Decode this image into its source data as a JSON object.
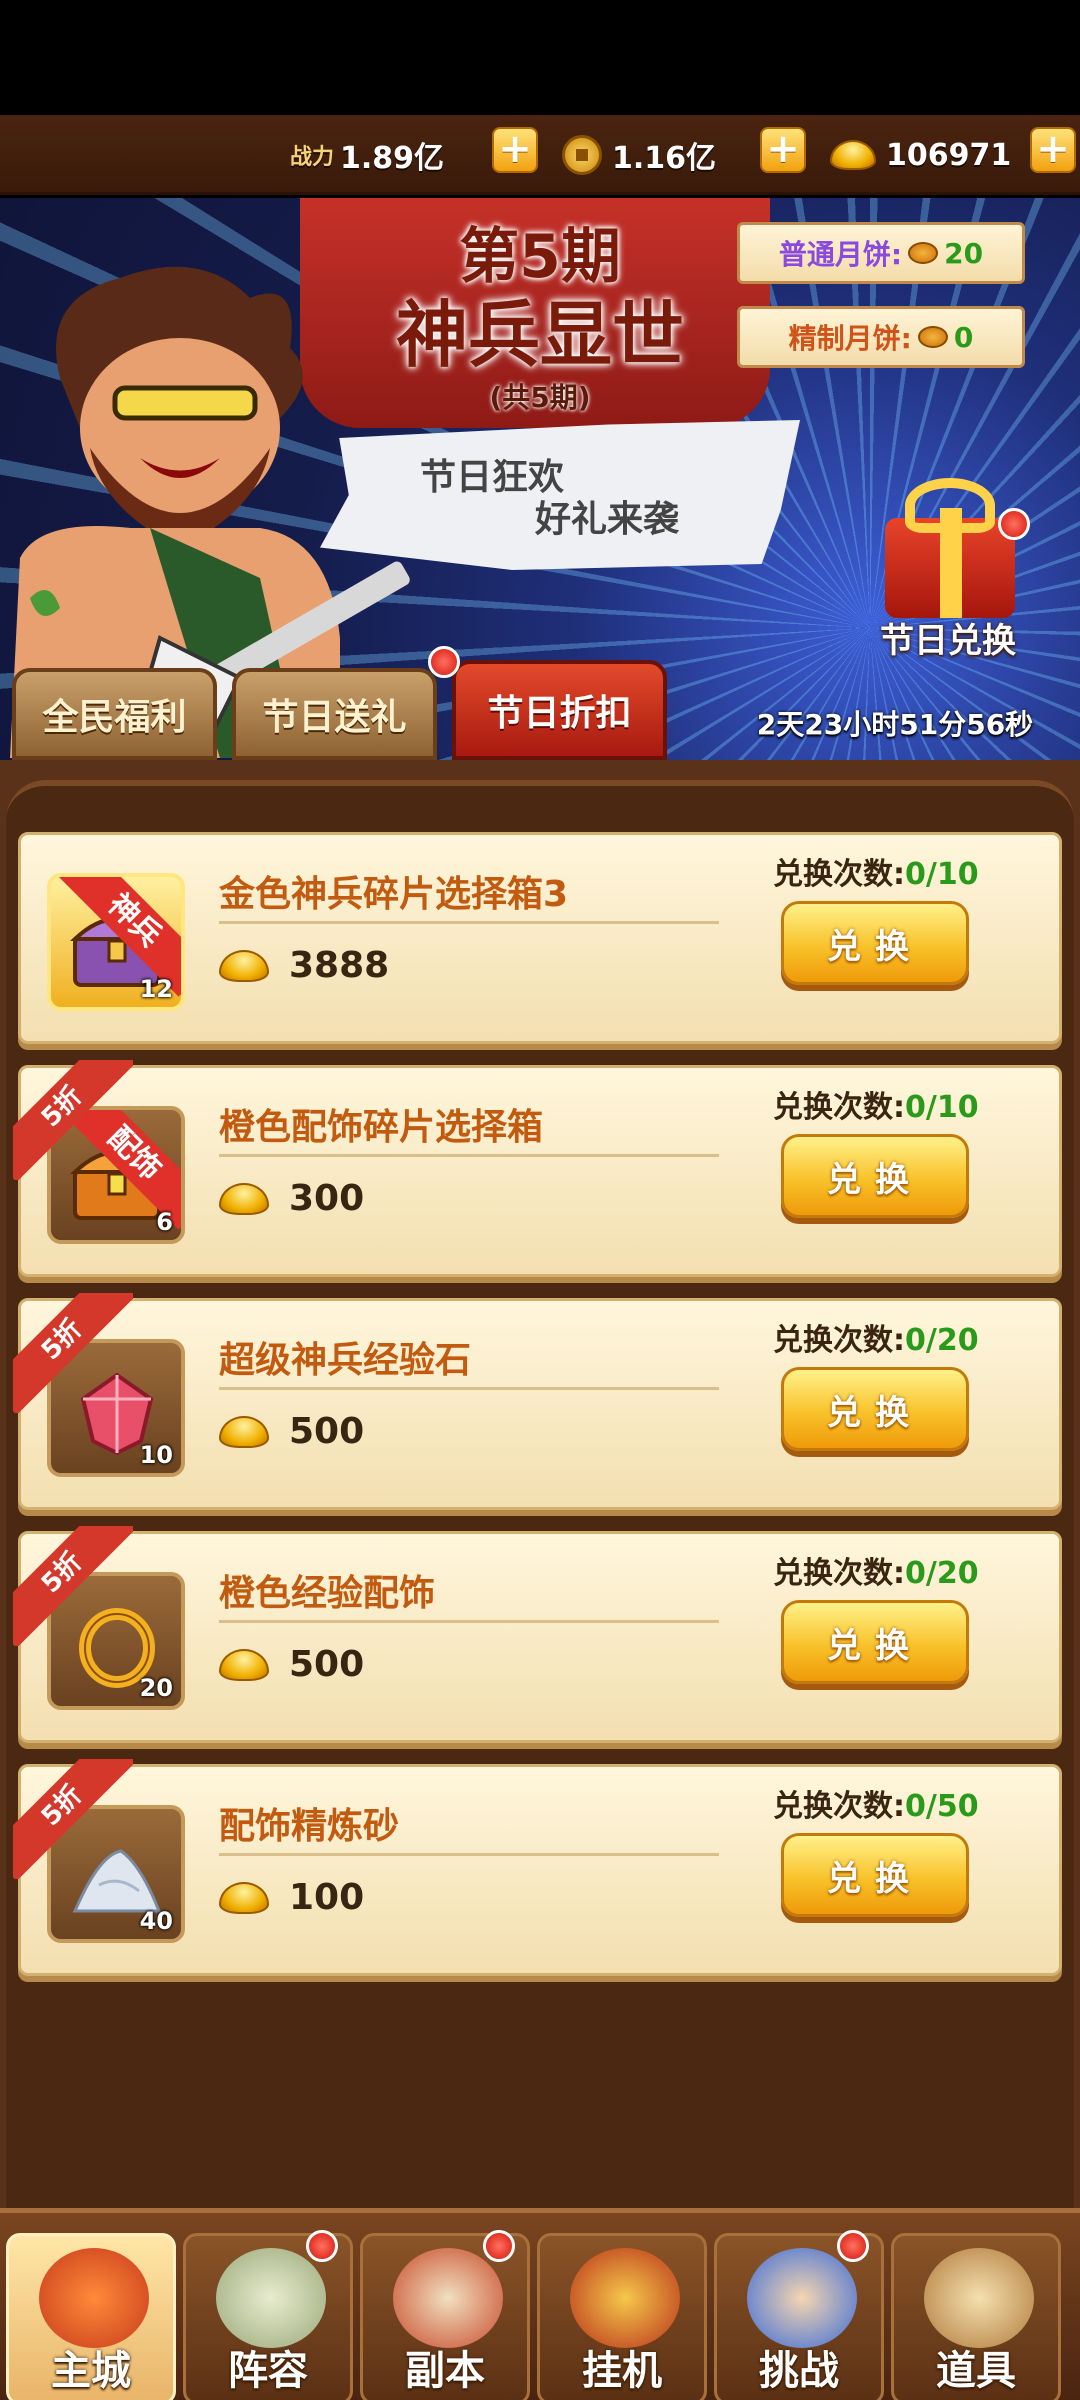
{
  "resources": {
    "power_label": "战力",
    "power_value": "1.89亿",
    "coins_value": "1.16亿",
    "ingots_value": "106971"
  },
  "banner": {
    "period": "第5期",
    "title": "神兵显世",
    "total": "(共5期)",
    "speech_line1": "节日狂欢",
    "speech_line2": "好礼来袭",
    "mooncake_normal_label": "普通月饼:",
    "mooncake_normal_count": "20",
    "mooncake_fine_label": "精制月饼:",
    "mooncake_fine_count": "0",
    "exchange_label": "节日兑换",
    "countdown": "2天23小时51分56秒"
  },
  "tabs": [
    {
      "label": "全民福利",
      "active": false
    },
    {
      "label": "节日送礼",
      "active": false
    },
    {
      "label": "节日折扣",
      "active": true
    }
  ],
  "items": [
    {
      "name": "金色神兵碎片选择箱3",
      "price": "3888",
      "limit_label": "兑换次数:",
      "limit": "0/10",
      "button": "兑换",
      "count": "12",
      "ribbon": "神兵",
      "discount": ""
    },
    {
      "name": "橙色配饰碎片选择箱",
      "price": "300",
      "limit_label": "兑换次数:",
      "limit": "0/10",
      "button": "兑换",
      "count": "6",
      "ribbon": "配饰",
      "discount": "5折"
    },
    {
      "name": "超级神兵经验石",
      "price": "500",
      "limit_label": "兑换次数:",
      "limit": "0/20",
      "button": "兑换",
      "count": "10",
      "ribbon": "",
      "discount": "5折"
    },
    {
      "name": "橙色经验配饰",
      "price": "500",
      "limit_label": "兑换次数:",
      "limit": "0/20",
      "button": "兑换",
      "count": "20",
      "ribbon": "",
      "discount": "5折"
    },
    {
      "name": "配饰精炼砂",
      "price": "100",
      "limit_label": "兑换次数:",
      "limit": "0/50",
      "button": "兑换",
      "count": "40",
      "ribbon": "",
      "discount": "5折"
    }
  ],
  "nav": [
    {
      "label": "主城",
      "icon": "city-icon"
    },
    {
      "label": "阵容",
      "icon": "lineup-icon"
    },
    {
      "label": "副本",
      "icon": "dungeon-icon"
    },
    {
      "label": "挂机",
      "icon": "idle-icon"
    },
    {
      "label": "挑战",
      "icon": "challenge-icon"
    },
    {
      "label": "道具",
      "icon": "items-icon"
    }
  ],
  "colors": {
    "accent_red": "#d4382a",
    "gold": "#f8c22a",
    "count_green": "#2a9a1a",
    "item_name": "#c25a10"
  }
}
